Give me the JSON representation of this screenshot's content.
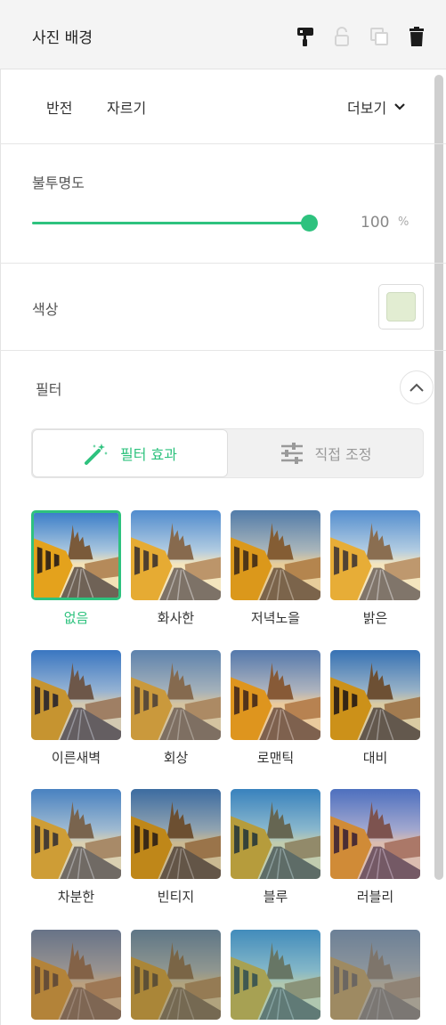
{
  "header": {
    "title": "사진 배경",
    "icons": [
      "paint-roller-icon",
      "lock-icon",
      "duplicate-icon",
      "trash-icon"
    ]
  },
  "tabs": {
    "flip": "반전",
    "crop": "자르기",
    "more": "더보기"
  },
  "opacity": {
    "label": "불투명도",
    "value": "100",
    "unit": "%",
    "level": 1.0
  },
  "color": {
    "label": "색상",
    "swatch": "#e2edd2"
  },
  "filter": {
    "label": "필터",
    "seg_effects": "필터 효과",
    "seg_adjust": "직접 조정",
    "items": [
      {
        "label": "없음",
        "selected": true
      },
      {
        "label": "화사한"
      },
      {
        "label": "저녁노을"
      },
      {
        "label": "밝은"
      },
      {
        "label": "이른새벽"
      },
      {
        "label": "회상"
      },
      {
        "label": "로맨틱"
      },
      {
        "label": "대비"
      },
      {
        "label": "차분한"
      },
      {
        "label": "빈티지"
      },
      {
        "label": "블루"
      },
      {
        "label": "러블리"
      },
      {
        "label": ""
      },
      {
        "label": ""
      },
      {
        "label": ""
      },
      {
        "label": ""
      }
    ]
  },
  "colors": {
    "accent": "#2ec27e"
  }
}
